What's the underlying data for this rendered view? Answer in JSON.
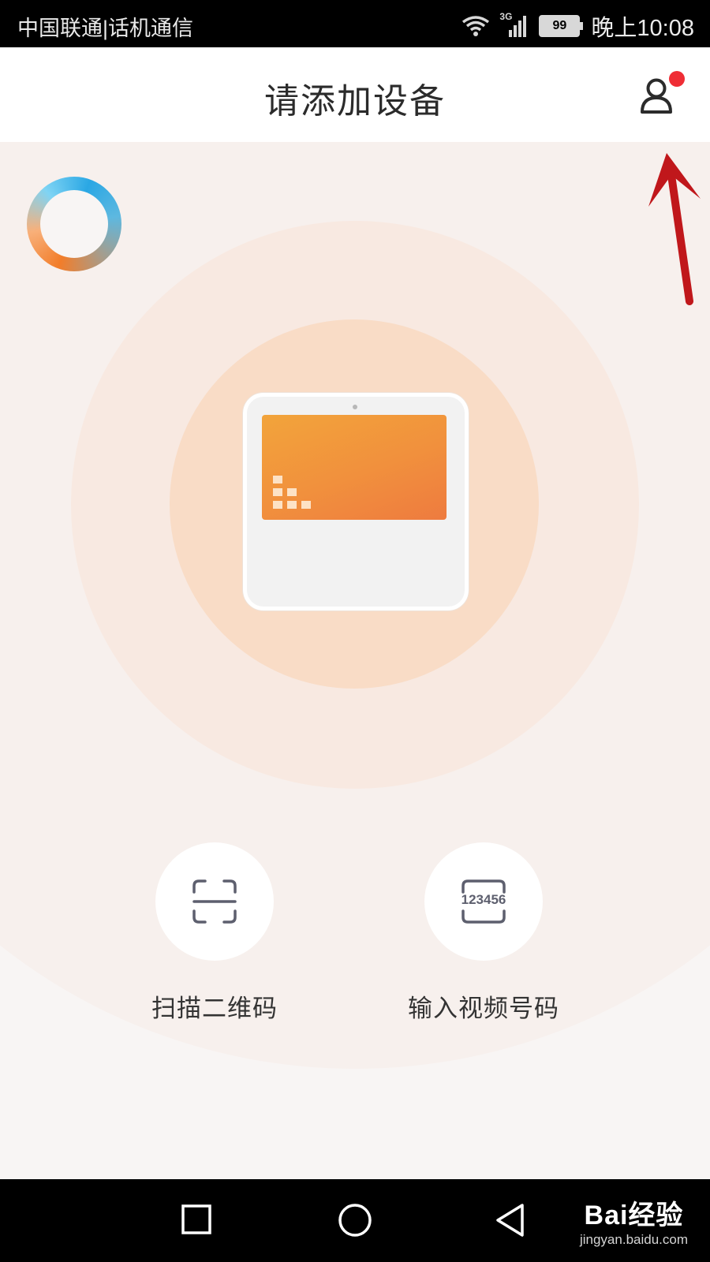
{
  "status_bar": {
    "carrier": "中国联通|话机通信",
    "network": "3G",
    "battery": "99",
    "time": "晚上10:08"
  },
  "header": {
    "title": "请添加设备",
    "profile_icon": "user-icon",
    "notification_color": "#ef2d35"
  },
  "device_illustration": {
    "icon": "smart-screen-device"
  },
  "actions": {
    "scan": {
      "label": "扫描二维码",
      "icon": "qr-scan-icon"
    },
    "video_number": {
      "label": "输入视频号码",
      "icon_text": "123456"
    }
  },
  "watermark": {
    "brand": "Bai经验",
    "url": "jingyan.baidu.com"
  },
  "colors": {
    "accent_orange": "#f1903d",
    "annotation_arrow": "#c0171b"
  }
}
